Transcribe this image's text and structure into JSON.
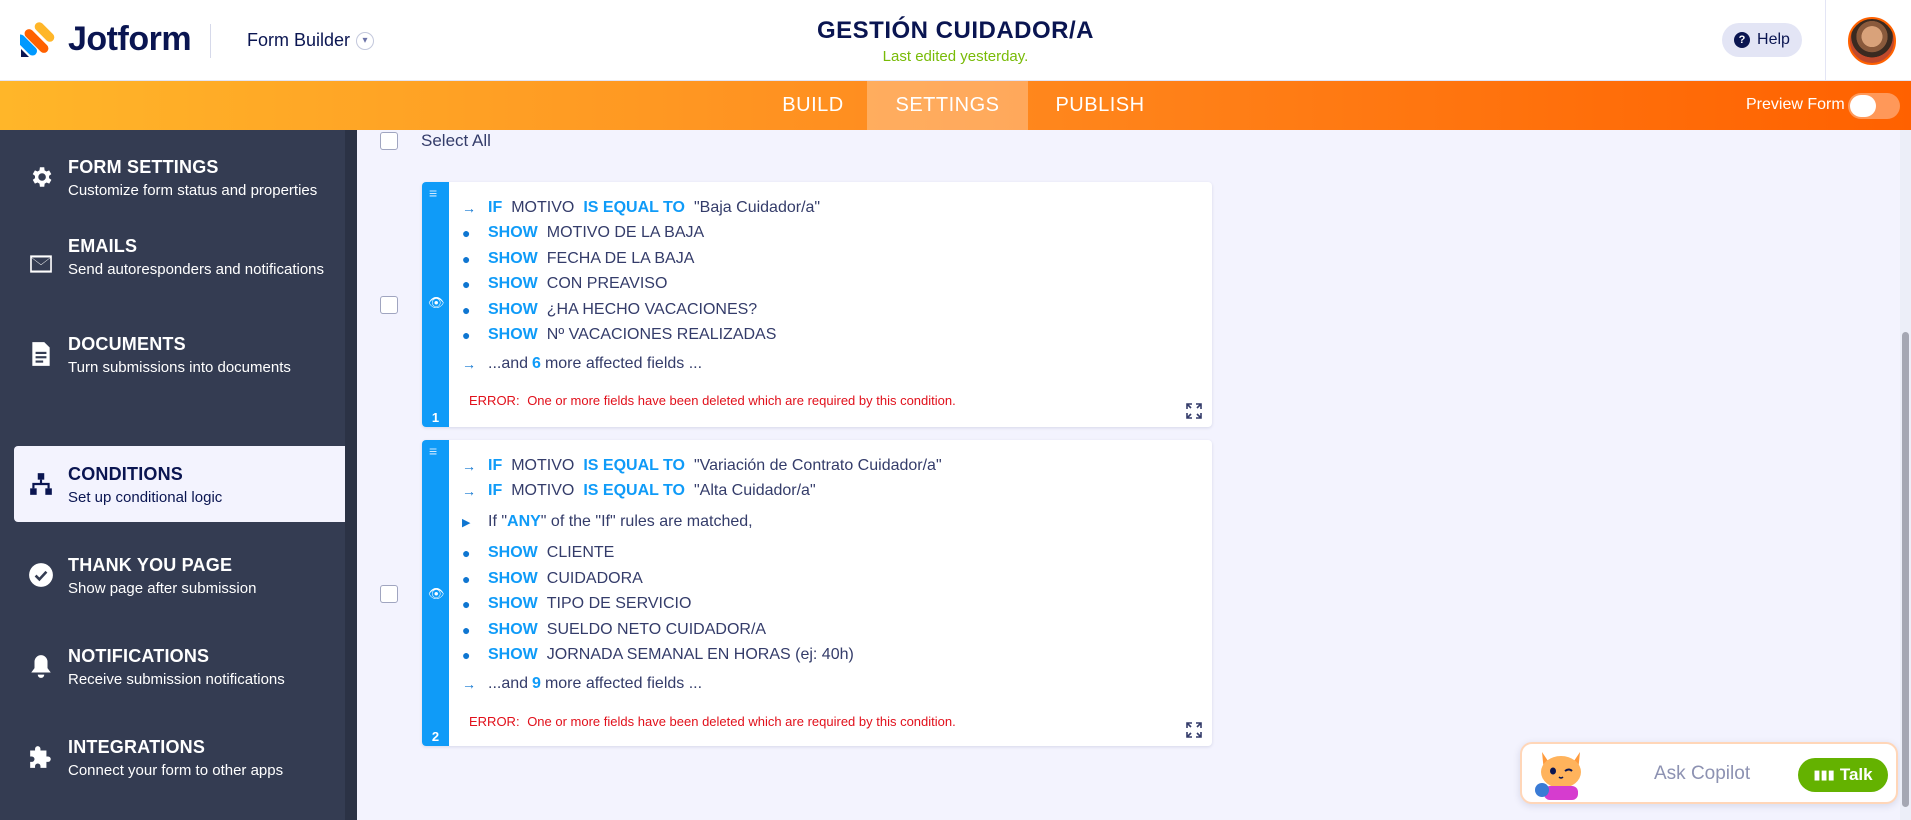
{
  "header": {
    "logo_text": "Jotform",
    "builder_label": "Form Builder",
    "form_title": "GESTIÓN CUIDADOR/A",
    "last_edited": "Last edited yesterday.",
    "help_label": "Help"
  },
  "nav": {
    "tabs": [
      {
        "label": "BUILD"
      },
      {
        "label": "SETTINGS"
      },
      {
        "label": "PUBLISH"
      }
    ],
    "active_tab": "SETTINGS",
    "preview_label": "Preview Form"
  },
  "sidebar": {
    "items": [
      {
        "title": "FORM SETTINGS",
        "desc": "Customize form status and properties",
        "icon": "gear-icon"
      },
      {
        "title": "EMAILS",
        "desc": "Send autoresponders and notifications",
        "icon": "envelope-icon"
      },
      {
        "title": "DOCUMENTS",
        "desc": "Turn submissions into documents",
        "icon": "document-icon"
      },
      {
        "title": "CONDITIONS",
        "desc": "Set up conditional logic",
        "icon": "conditions-icon"
      },
      {
        "title": "THANK YOU PAGE",
        "desc": "Show page after submission",
        "icon": "check-circle-icon"
      },
      {
        "title": "NOTIFICATIONS",
        "desc": "Receive submission notifications",
        "icon": "bell-icon"
      },
      {
        "title": "INTEGRATIONS",
        "desc": "Connect your form to other apps",
        "icon": "puzzle-icon"
      }
    ],
    "active": "CONDITIONS"
  },
  "main": {
    "select_all": "Select All",
    "conditions": [
      {
        "number": "1",
        "rules": [
          {
            "kw": "IF",
            "field": "MOTIVO",
            "op": "IS EQUAL TO",
            "value": "\"Baja Cuidador/a\""
          }
        ],
        "actions": [
          {
            "kw": "SHOW",
            "field": "MOTIVO DE LA BAJA"
          },
          {
            "kw": "SHOW",
            "field": "FECHA DE LA BAJA"
          },
          {
            "kw": "SHOW",
            "field": "CON PREAVISO"
          },
          {
            "kw": "SHOW",
            "field": "¿HA HECHO VACACIONES?"
          },
          {
            "kw": "SHOW",
            "field": "Nº VACACIONES REALIZADAS"
          }
        ],
        "more_prefix": "...and",
        "more_count": "6",
        "more_suffix": "more affected fields ...",
        "error_label": "ERROR:",
        "error_text": "One or more fields have been deleted which are required by this condition."
      },
      {
        "number": "2",
        "rules": [
          {
            "kw": "IF",
            "field": "MOTIVO",
            "op": "IS EQUAL TO",
            "value": "\"Variación de Contrato Cuidador/a\""
          },
          {
            "kw": "IF",
            "field": "MOTIVO",
            "op": "IS EQUAL TO",
            "value": "\"Alta Cuidador/a\""
          }
        ],
        "match_prefix": "If \"",
        "match_kw": "ANY",
        "match_suffix": "\" of the \"If\" rules are matched,",
        "actions": [
          {
            "kw": "SHOW",
            "field": "CLIENTE"
          },
          {
            "kw": "SHOW",
            "field": "CUIDADORA"
          },
          {
            "kw": "SHOW",
            "field": "TIPO DE SERVICIO"
          },
          {
            "kw": "SHOW",
            "field": "SUELDO NETO CUIDADOR/A"
          },
          {
            "kw": "SHOW",
            "field": "JORNADA SEMANAL EN HORAS (ej: 40h)"
          }
        ],
        "more_prefix": "...and",
        "more_count": "9",
        "more_suffix": "more affected fields ...",
        "error_label": "ERROR:",
        "error_text": "One or more fields have been deleted which are required by this condition."
      }
    ]
  },
  "copilot": {
    "placeholder": "Ask Copilot",
    "talk_label": "Talk"
  },
  "colors": {
    "accent_blue": "#0f9bf8",
    "nav_orange": "#ff6100",
    "error_red": "#e1101b",
    "edited_green": "#78bb07",
    "sidebar_bg": "#343c52"
  }
}
